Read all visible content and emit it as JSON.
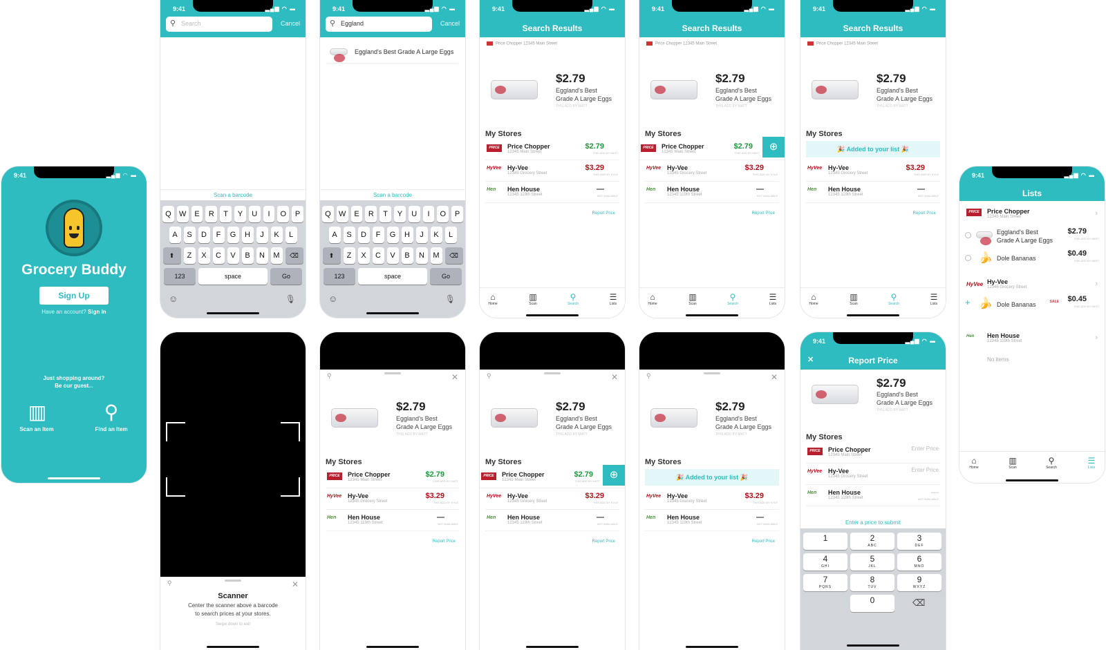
{
  "status": {
    "time": "9:41",
    "icons": "▂▄▆ ◠ ▬"
  },
  "welcome": {
    "title": "Grocery Buddy",
    "signup": "Sign Up",
    "have_account": "Have an account?",
    "signin": "Sign In",
    "guest1": "Just shopping around?",
    "guest2": "Be our guest...",
    "scan": "Scan an Item",
    "find": "Find an Item"
  },
  "search1": {
    "placeholder": "Search",
    "cancel": "Cancel",
    "scan_barcode": "Scan a barcode"
  },
  "search2": {
    "value": "Eggland",
    "cancel": "Cancel",
    "suggestion": "Eggland's Best Grade A Large Eggs",
    "scan_barcode": "Scan a barcode"
  },
  "keyboard": {
    "row1": [
      "Q",
      "W",
      "E",
      "R",
      "T",
      "Y",
      "U",
      "I",
      "O",
      "P"
    ],
    "row2": [
      "A",
      "S",
      "D",
      "F",
      "G",
      "H",
      "J",
      "K",
      "L"
    ],
    "row3": [
      "Z",
      "X",
      "C",
      "V",
      "B",
      "N",
      "M"
    ],
    "num": "123",
    "space": "space",
    "go": "Go"
  },
  "results": {
    "title": "Search Results",
    "store_line": "Price Chopper 12345 Main Street",
    "price": "$2.79",
    "name1": "Eggland's Best",
    "name2": "Grade A Large Eggs",
    "note": "THIS ADD BY MATT",
    "my_stores": "My Stores",
    "report": "Report Price",
    "added": "🎉 Added to your list 🎉",
    "stores": [
      {
        "logo": "PRICE",
        "name": "Price Chopper",
        "addr": "12345 Main Street",
        "price": "$2.79",
        "note": "THIS ADD BY MATT",
        "color": "#1b9a3c"
      },
      {
        "logo": "HyVee",
        "name": "Hy-Vee",
        "addr": "12345 Grocery Street",
        "price": "$3.29",
        "note": "THIS ADD BY KYLE",
        "color": "#b0101a"
      },
      {
        "logo": "Hen",
        "name": "Hen House",
        "addr": "12345 119th Street",
        "price": "—",
        "note": "NOT AVAILABLE",
        "color": "#333"
      }
    ]
  },
  "tabs": {
    "home": "Home",
    "scan": "Scan",
    "search": "Search",
    "lists": "Lists"
  },
  "scanner": {
    "title": "Scanner",
    "line1": "Center the scanner above a barcode",
    "line2": "to search prices at your stores.",
    "hint": "Swipe down to exit"
  },
  "report_screen": {
    "title": "Report Price",
    "close": "✕",
    "enter1": "Enter Price",
    "enter2": "Enter Price",
    "submit": "Enter a price to submit",
    "keys": [
      [
        "1",
        ""
      ],
      [
        "2",
        "ABC"
      ],
      [
        "3",
        "DEF"
      ],
      [
        "4",
        "GHI"
      ],
      [
        "5",
        "JKL"
      ],
      [
        "6",
        "MNO"
      ],
      [
        "7",
        "PQRS"
      ],
      [
        "8",
        "TUV"
      ],
      [
        "9",
        "WXYZ"
      ],
      [
        "0",
        ""
      ]
    ],
    "backspace": "⌫"
  },
  "lists": {
    "title": "Lists",
    "s1": "Price Chopper",
    "s1a": "12345 Main Street",
    "i1a": "Eggland's Best",
    "i1b": "Grade A Large Eggs",
    "i1p": "$2.79",
    "i1n": "THIS ADD BY MATT",
    "i2": "Dole Bananas",
    "i2p": "$0.49",
    "i2n": "THIS ADD BY MATT",
    "s2": "Hy-Vee",
    "s2a": "12345 Grocery Street",
    "i3": "Dole Bananas",
    "i3p": "$0.45",
    "i3s": "SALE",
    "i3n": "THIS ADD BY MATT",
    "s3": "Hen House",
    "s3a": "12345 119th Street",
    "empty": "No items"
  }
}
